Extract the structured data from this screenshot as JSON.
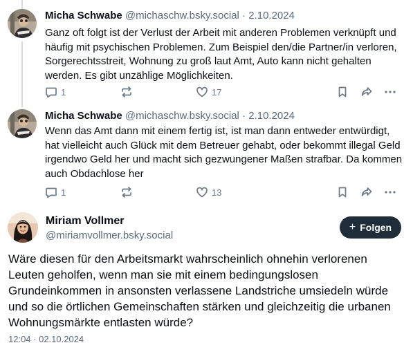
{
  "thread_posts": [
    {
      "author": "Micha Schwabe",
      "handle": "@michaschw.bsky.social",
      "separator": "·",
      "date": "2.10.2024",
      "text": "Ganz oft folgt ist der Verlust der Arbeit mit anderen Problemen verknüpft und häufig mit psychischen Problemen. Zum Beispiel den/die Partner/in verloren, Sorgerechtsstreit, Wohnung zu groß laut Amt, Auto kann nicht gehalten werden. Es gibt unzählige Möglichkeiten.",
      "replies": "1",
      "reposts": "",
      "likes": "17"
    },
    {
      "author": "Micha Schwabe",
      "handle": "@michaschw.bsky.social",
      "separator": "·",
      "date": "2.10.2024",
      "text": "Wenn das Amt dann mit einem fertig ist, ist man dann entweder entwürdigt, hat vielleicht auch Glück mit dem Betreuer gehabt, oder bekommt illegal Geld irgendwo Geld her und macht sich gezwungener Maßen strafbar. Da kommen auch Obdachlose her",
      "replies": "1",
      "reposts": "",
      "likes": "13"
    }
  ],
  "main_post": {
    "author": "Miriam Vollmer",
    "handle": "@miriamvollmer.bsky.social",
    "follow_label": "Folgen",
    "follow_icon": "+",
    "text": "Wäre diesen für den Arbeitsmarkt wahrscheinlich ohnehin verlorenen Leuten geholfen, wenn man sie mit einem bedingungslosen Grundeinkommen in ansonsten verlassene Landstriche umsiedeln würde und so die örtlichen Gemeinschaften stärken und gleichzeitig die urbanen Wohnungsmärkte entlasten würde?",
    "timestamp": "12:04 · 02.10.2024"
  },
  "icons": {
    "reply": "reply-icon",
    "repost": "repost-icon",
    "like": "heart-icon",
    "bookmark": "bookmark-icon",
    "share": "share-icon",
    "more": "more-icon"
  },
  "colors": {
    "text": "#0b0f14",
    "muted": "#5b6b7a",
    "icon": "#6b7a89",
    "thread_line": "#d4dbe2",
    "follow_button": "#1f2d3a"
  }
}
